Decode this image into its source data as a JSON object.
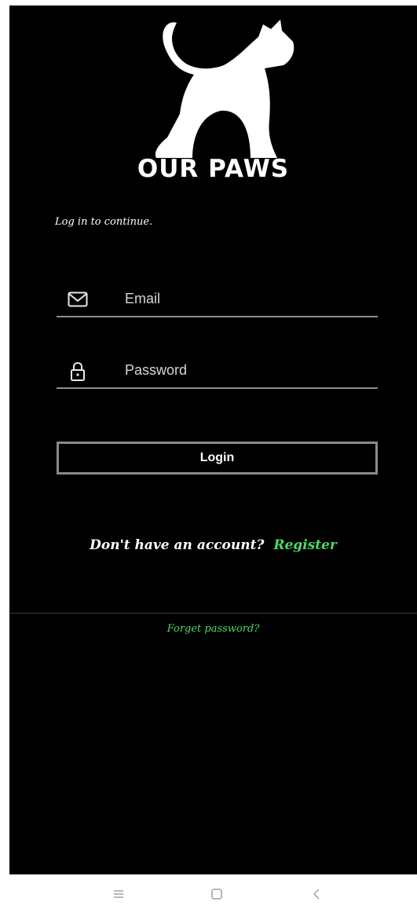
{
  "app": {
    "brand": "OUR PAWS",
    "logo_icon": "cat-silhouette-icon",
    "colors": {
      "background": "#000000",
      "accent": "#4cd964",
      "line": "#8d8d8d"
    }
  },
  "login": {
    "intro": "Log in to continue.",
    "email": {
      "placeholder": "Email",
      "value": "",
      "icon": "mail-icon"
    },
    "password": {
      "placeholder": "Password",
      "value": "",
      "icon": "lock-icon"
    },
    "login_label": "Login",
    "no_account_text": "Don't have an account?",
    "register_label": "Register",
    "forgot_label": "Forget password?"
  },
  "navbar": {
    "icons": [
      "menu-icon",
      "home-icon",
      "back-icon"
    ]
  }
}
